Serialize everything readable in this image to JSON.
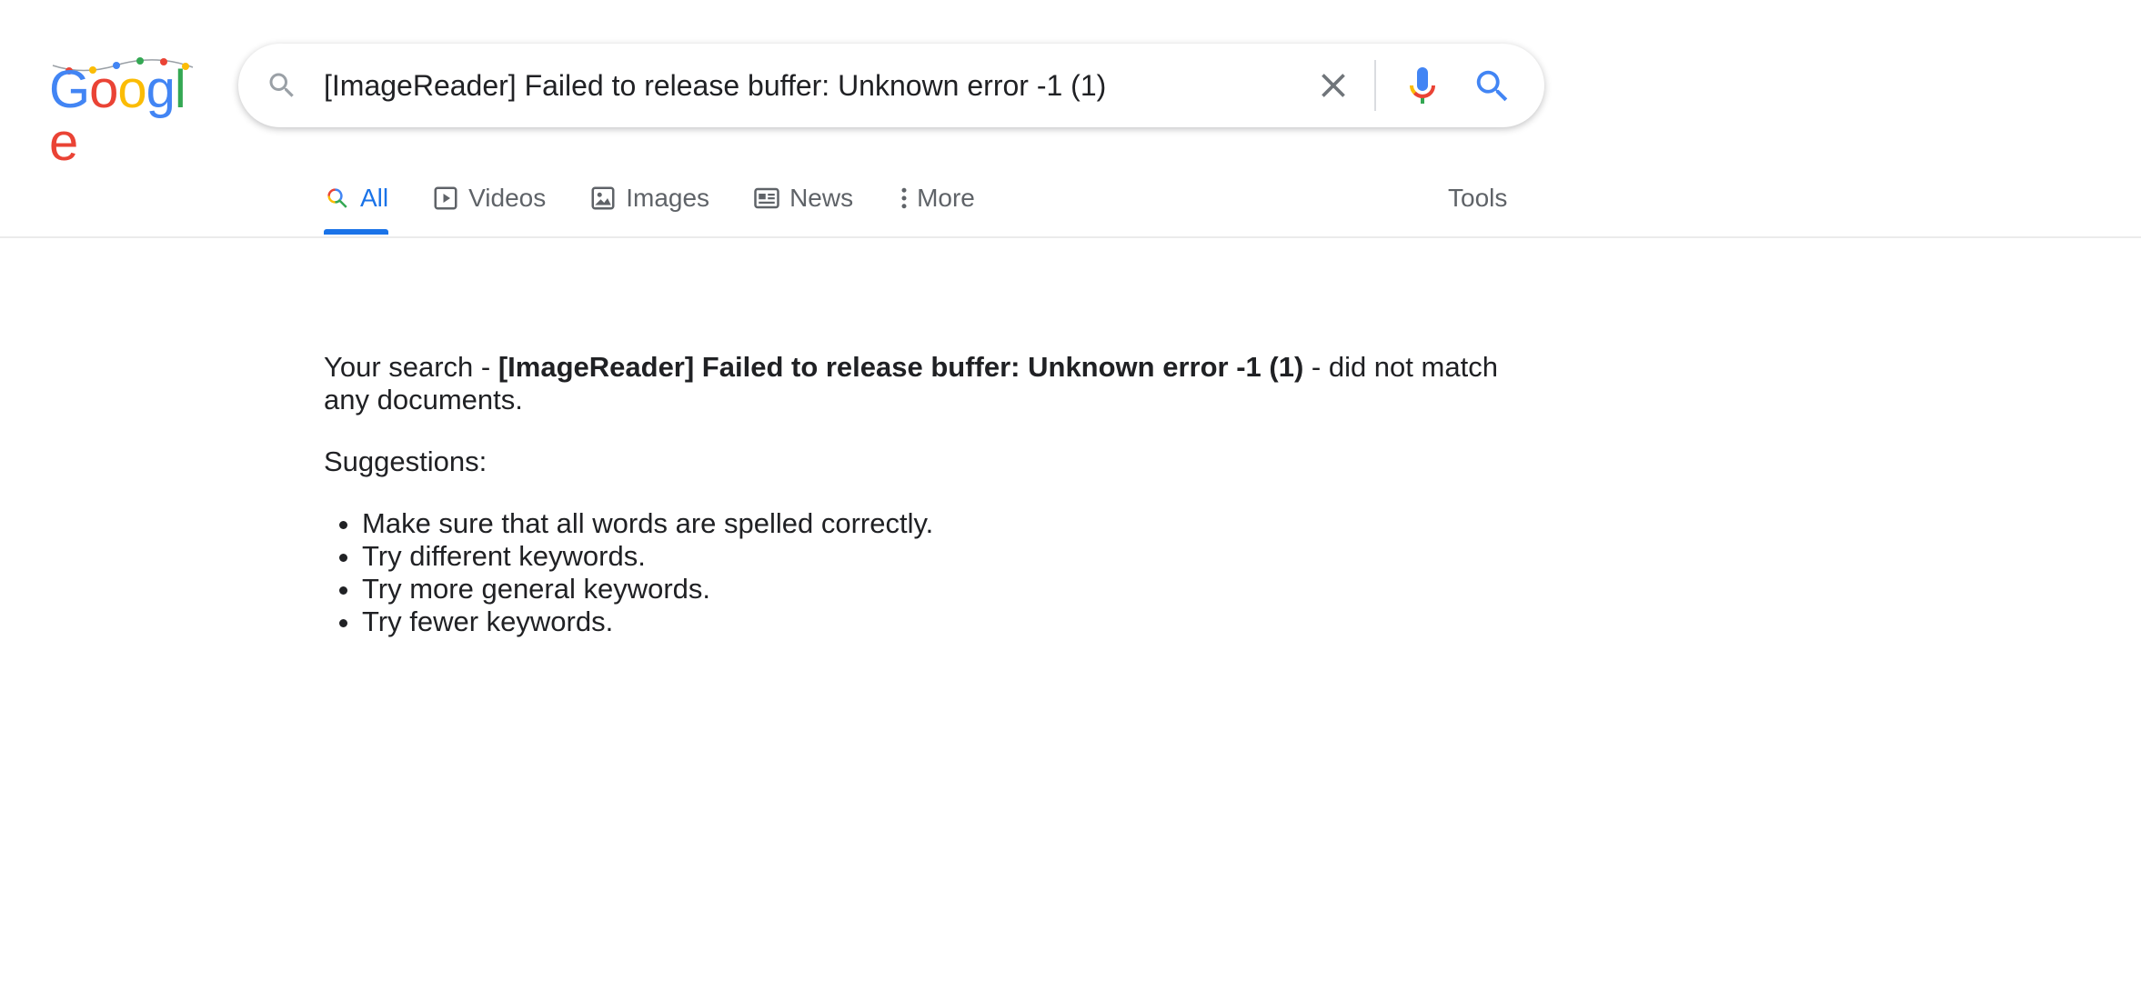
{
  "logo": {
    "text": "Google",
    "colors": [
      "#4285F4",
      "#EA4335",
      "#FBBC05",
      "#4285F4",
      "#34A853",
      "#EA4335"
    ]
  },
  "search": {
    "query": "[ImageReader] Failed to release buffer: Unknown error -1 (1)",
    "icons": [
      "search-icon",
      "close-icon",
      "microphone-icon",
      "search-icon"
    ]
  },
  "tabs": [
    {
      "label": "All",
      "icon": "search-icon",
      "active": true
    },
    {
      "label": "Videos",
      "icon": "play-icon",
      "active": false
    },
    {
      "label": "Images",
      "icon": "image-icon",
      "active": false
    },
    {
      "label": "News",
      "icon": "newspaper-icon",
      "active": false
    },
    {
      "label": "More",
      "icon": "more-vert-icon",
      "active": false
    }
  ],
  "tools_label": "Tools",
  "result": {
    "prefix": "Your search - ",
    "query": "[ImageReader] Failed to release buffer: Unknown error -1 (1)",
    "suffix": " - did not match any documents.",
    "suggestions_title": "Suggestions:",
    "suggestions": [
      "Make sure that all words are spelled correctly.",
      "Try different keywords.",
      "Try more general keywords.",
      "Try fewer keywords."
    ]
  },
  "colors": {
    "accent": "#1a73e8",
    "text": "#202124",
    "muted": "#5f6368"
  }
}
